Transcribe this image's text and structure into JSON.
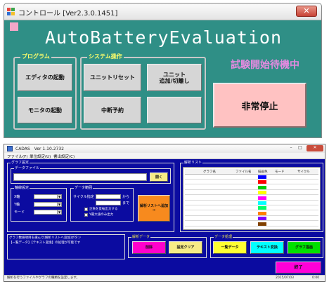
{
  "control_window": {
    "title": "コントロール [Ver2.3.0.1451]",
    "close_glyph": "✕",
    "app_title": "AutoBatteryEvaluation",
    "program_group": {
      "label": "プログラム",
      "buttons": [
        "エディタの起動",
        "モニタの起動"
      ]
    },
    "system_group": {
      "label": "システム操作",
      "unit_reset": "ユニットリセット",
      "unit_add": [
        "ユニット",
        "追加/切離し"
      ],
      "suspend": "中断予約",
      "blank": ""
    },
    "status_text": "試験開始待機中",
    "emergency_stop": "非常停止"
  },
  "cadas_window": {
    "title": "CADAS　Ver 1.10.2732",
    "controls": {
      "minimize": "–",
      "maximize": "□",
      "close": "✕"
    },
    "menu": [
      "ファイル(F)",
      "単位設定(U)",
      "書出設定(C)"
    ],
    "graph_settings": {
      "label": "グラフ設定",
      "data_file": {
        "label": "データファイル",
        "open_button": "開く",
        "value": ""
      },
      "axis_settings": {
        "label": "軸線設定",
        "rows": [
          {
            "label": "X軸",
            "value": ""
          },
          {
            "label": "Y軸",
            "value": ""
          },
          {
            "label": "モード",
            "value": ""
          }
        ]
      },
      "data_range": {
        "label": "データ範囲",
        "cycle_label": "サイクル指定",
        "from": "から",
        "to": "まで",
        "check1": "正負を反転出力する",
        "check2": "Y最大値のみ出力"
      },
      "add_button": [
        "解析リストへ追加",
        "⇒"
      ]
    },
    "analysis_list": {
      "label": "解析リスト",
      "columns": [
        "グラフ名",
        "ファイル名",
        "描画色",
        "モード",
        "サイクル"
      ],
      "row_colors": [
        "#0000ff",
        "#ff0000",
        "#00cc00",
        "#ffff00",
        "#ff00ff",
        "#00ffff",
        "#00ff66",
        "#ff8000",
        "#8000ff",
        "#804000"
      ]
    },
    "info_text": [
      "グラフ数値項目を選んで[解析リストへ追加]ボタン",
      "【一覧データ】【テキスト変換】の処理が可能です"
    ],
    "analysis_data": {
      "label": "解析データ",
      "delete": "削除",
      "clear": "設定クリア"
    },
    "data_processing": {
      "label": "データ処理",
      "list_data": "一覧データ",
      "text_convert": "テキスト変換",
      "graph_draw": "グラフ描画"
    },
    "exit_button": "終了",
    "status_left": "解析を行うファイルやグラフの種類を設定します。",
    "status_date": "2015/07/03",
    "status_time": "0:00"
  },
  "colors": {
    "control_bg": "#2f8f86",
    "cadas_bg": "#0b0ba0",
    "status_text": "#e48ae0",
    "emergency": "#ffc2c2"
  }
}
